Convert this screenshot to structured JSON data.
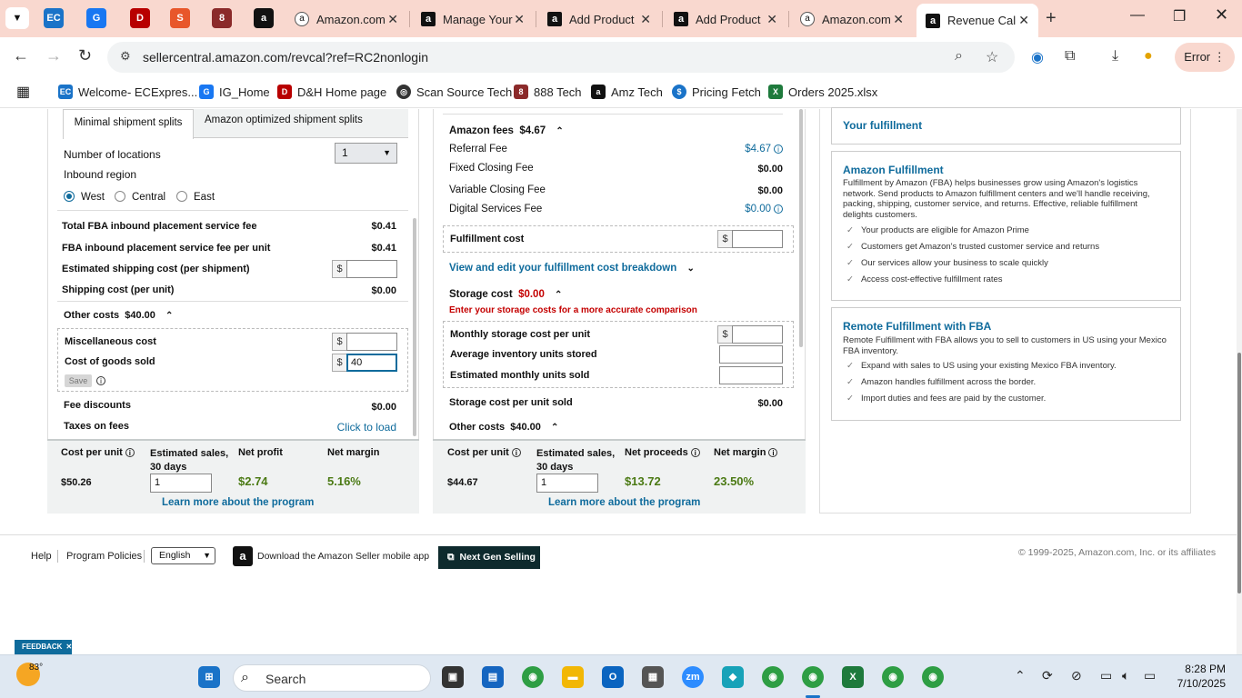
{
  "browser": {
    "tabs": [
      {
        "title": "Amazon.com"
      },
      {
        "title": "Manage Your"
      },
      {
        "title": "Add Product"
      },
      {
        "title": "Add Product"
      },
      {
        "title": "Amazon.com"
      },
      {
        "title": "Revenue Cal"
      }
    ],
    "url": "sellercentral.amazon.com/revcal?ref=RC2nonlogin",
    "error_label": "Error",
    "bookmarks": [
      {
        "label": "Welcome- ECExpres..."
      },
      {
        "label": "IG_Home"
      },
      {
        "label": "D&H Home page"
      },
      {
        "label": "Scan Source Tech"
      },
      {
        "label": "888 Tech"
      },
      {
        "label": "Amz Tech"
      },
      {
        "label": "Pricing Fetch"
      },
      {
        "label": "Orders 2025.xlsx"
      }
    ]
  },
  "left": {
    "tabs": [
      "Minimal shipment splits",
      "Amazon optimized shipment splits"
    ],
    "num_locations_label": "Number of locations",
    "num_locations_value": "1",
    "inbound_region_label": "Inbound region",
    "regions": [
      "West",
      "Central",
      "East"
    ],
    "rows": [
      {
        "label": "Total FBA inbound placement service fee",
        "value": "$0.41"
      },
      {
        "label": "FBA inbound placement service fee per unit",
        "value": "$0.41"
      },
      {
        "label": "Estimated shipping cost (per shipment)",
        "value": ""
      },
      {
        "label": "Shipping cost (per unit)",
        "value": "$0.00"
      }
    ],
    "other_costs_label": "Other costs",
    "other_costs_value": "$40.00",
    "misc_label": "Miscellaneous cost",
    "cogs_label": "Cost of goods sold",
    "cogs_value": "40",
    "dollar": "$",
    "save_label": "Save",
    "fee_discounts_label": "Fee discounts",
    "fee_discounts_value": "$0.00",
    "taxes_label": "Taxes on fees",
    "taxes_link": "Click to load",
    "summary": {
      "cost_per_unit_label": "Cost per unit",
      "est_sales_label": "Estimated sales, 30 days",
      "profit_label": "Net profit",
      "margin_label": "Net margin",
      "cost_per_unit": "$50.26",
      "est_sales": "1",
      "profit": "$2.74",
      "margin": "5.16%",
      "learn_more": "Learn more about the program"
    }
  },
  "middle": {
    "amazon_fees_label": "Amazon fees",
    "amazon_fees_value": "$4.67",
    "fees": [
      {
        "label": "Referral Fee",
        "value": "$4.67"
      },
      {
        "label": "Fixed Closing Fee",
        "value": "$0.00"
      },
      {
        "label": "Variable Closing Fee",
        "value": "$0.00"
      },
      {
        "label": "Digital Services Fee",
        "value": "$0.00"
      }
    ],
    "fulfillment_cost_label": "Fulfillment cost",
    "view_breakdown": "View and edit your fulfillment cost breakdown",
    "storage_cost_label": "Storage cost",
    "storage_cost_value": "$0.00",
    "storage_warning": "Enter your storage costs for a more accurate comparison",
    "monthly_storage_label": "Monthly storage cost per unit",
    "avg_inventory_label": "Average inventory units stored",
    "est_monthly_label": "Estimated monthly units sold",
    "storage_per_unit_label": "Storage cost per unit sold",
    "storage_per_unit_value": "$0.00",
    "other_costs_label": "Other costs",
    "other_costs_value": "$40.00",
    "summary": {
      "cost_per_unit_label": "Cost per unit",
      "est_sales_label": "Estimated sales, 30 days",
      "proceeds_label": "Net proceeds",
      "margin_label": "Net margin",
      "cost_per_unit": "$44.67",
      "est_sales": "1",
      "proceeds": "$13.72",
      "margin": "23.50%",
      "learn_more": "Learn more about the program"
    }
  },
  "right": {
    "your_fulfillment": "Your fulfillment",
    "afn_title": "Amazon Fulfillment",
    "afn_desc": "Fulfillment by Amazon (FBA) helps businesses grow using Amazon's logistics network. Send products to Amazon fulfillment centers and we'll handle receiving, packing, shipping, customer service, and returns. Effective, reliable fulfillment delights customers.",
    "afn_items": [
      "Your products are eligible for Amazon Prime",
      "Customers get Amazon's trusted customer service and returns",
      "Our services allow your business to scale quickly",
      "Access cost-effective fulfillment rates"
    ],
    "remote_title": "Remote Fulfillment with FBA",
    "remote_desc": "Remote Fulfillment with FBA allows you to sell to customers in US using your Mexico FBA inventory.",
    "remote_items": [
      "Expand with sales to US using your existing Mexico FBA inventory.",
      "Amazon handles fulfillment across the border.",
      "Import duties and fees are paid by the customer."
    ]
  },
  "footer": {
    "help": "Help",
    "policies": "Program Policies",
    "language": "English",
    "download_app": "Download the Amazon Seller mobile app",
    "next_gen": "Next Gen Selling",
    "copyright": "© 1999-2025, Amazon.com, Inc. or its affiliates",
    "feedback": "FEEDBACK"
  },
  "taskbar": {
    "weather": "83°",
    "search_placeholder": "Search",
    "time": "8:28 PM",
    "date": "7/10/2025"
  }
}
